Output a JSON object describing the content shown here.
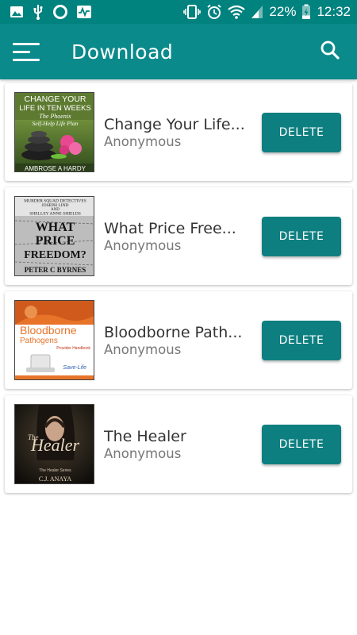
{
  "status_bar": {
    "battery": "22%",
    "time": "12:32"
  },
  "app_bar": {
    "title": "Download"
  },
  "colors": {
    "status_bar": "#00827f",
    "app_bar": "#0b8a8b",
    "button": "#0e7f80"
  },
  "books": [
    {
      "title": "Change Your Life...",
      "author": "Anonymous",
      "action": "DELETE",
      "cover_text": [
        "CHANGE YOUR",
        "LIFE IN TEN WEEKS",
        "The Phoenix",
        "Self-Help Life Plan",
        "AMBROSE A HARDY"
      ]
    },
    {
      "title": "What Price Free...",
      "author": "Anonymous",
      "action": "DELETE",
      "cover_text": [
        "MURDER SQUAD DETECTIVES",
        "JOSEPH LIND",
        "AND",
        "SHELLEY ANNE SHIELDS",
        "WHAT",
        "PRICE",
        "FREEDOM?",
        "PETER C BYRNES"
      ]
    },
    {
      "title": "Bloodborne Path...",
      "author": "Anonymous",
      "action": "DELETE",
      "cover_text": [
        "Bloodborne",
        "Pathogens",
        "Provider Handbook",
        "Save-Life"
      ]
    },
    {
      "title": "The Healer",
      "author": "Anonymous",
      "action": "DELETE",
      "cover_text": [
        "The",
        "Healer",
        "The Healer Series",
        "C.J. ANAYA"
      ]
    }
  ]
}
